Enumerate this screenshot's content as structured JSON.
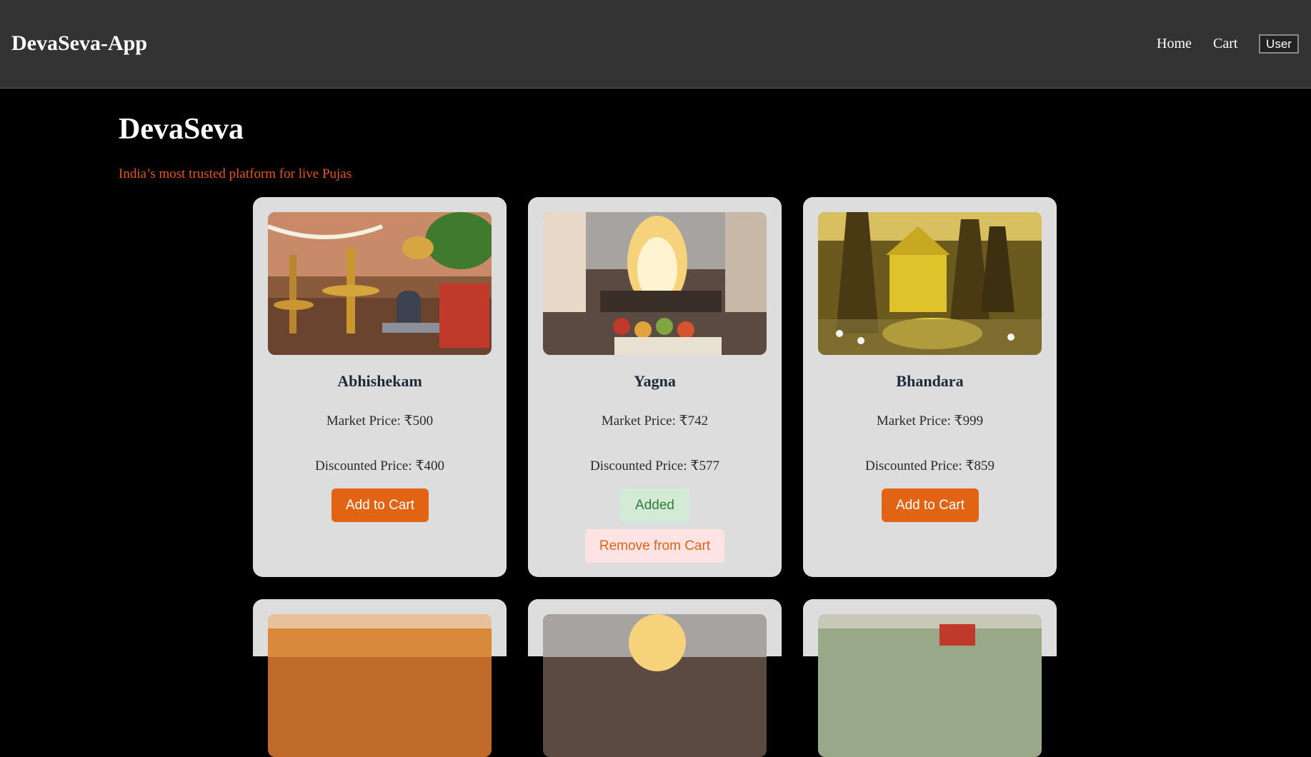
{
  "header": {
    "brand": "DevaSeva-App",
    "nav": {
      "home": "Home",
      "cart": "Cart",
      "user": "User"
    }
  },
  "main": {
    "title": "DevaSeva",
    "tagline": "India’s most trusted platform for live Pujas"
  },
  "products": [
    {
      "name": "Abhishekam",
      "market_price": "Market Price: ₹500",
      "discounted_price": "Discounted Price: ₹400",
      "add_label": "Add to Cart"
    },
    {
      "name": "Yagna",
      "market_price": "Market Price: ₹742",
      "discounted_price": "Discounted Price: ₹577",
      "added_label": "Added",
      "remove_label": "Remove from Cart"
    },
    {
      "name": "Bhandara",
      "market_price": "Market Price: ₹999",
      "discounted_price": "Discounted Price: ₹859",
      "add_label": "Add to Cart"
    }
  ],
  "colors": {
    "header_bg": "#333333",
    "page_bg": "#000000",
    "card_bg": "#dddddd",
    "accent": "#e06414",
    "added_bg": "#d3ebd6",
    "added_text": "#2e7d32",
    "remove_bg": "#fde3e3"
  }
}
